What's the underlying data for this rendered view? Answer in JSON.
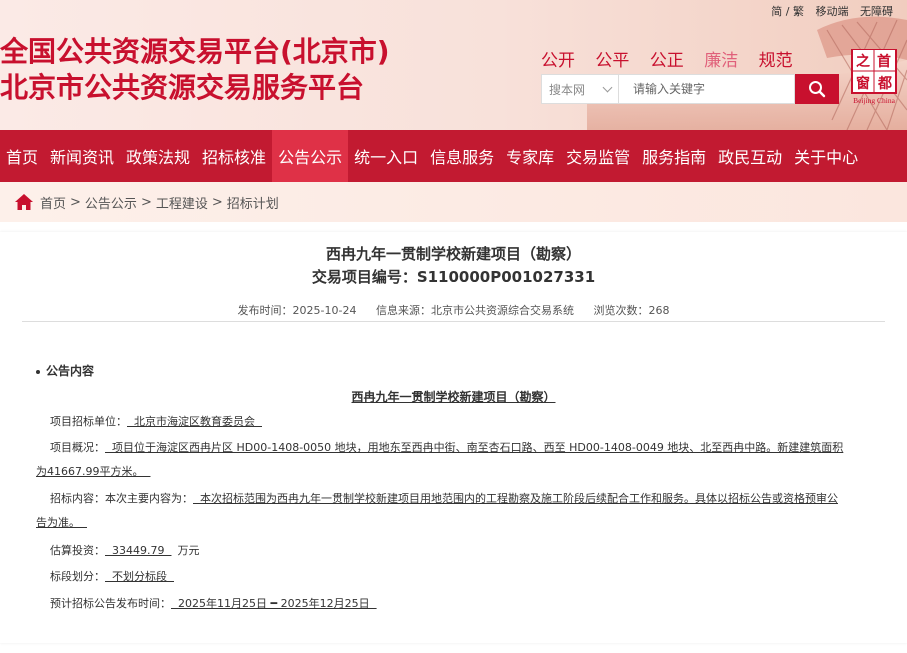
{
  "header": {
    "util_links": [
      "简 / 繁",
      "移动端",
      "无障碍"
    ],
    "title_line1": "全国公共资源交易平台(北京市)",
    "title_line2": "北京市公共资源交易服务平台",
    "slogans": [
      "公开",
      "公平",
      "公正",
      "廉洁",
      "规范"
    ],
    "search_scope": "搜本网",
    "search_placeholder": "请输入关键字",
    "logo_text": "Beijing China",
    "logo_chars": [
      "首",
      "都",
      "之",
      "窗"
    ]
  },
  "nav": {
    "items": [
      "首页",
      "新闻资讯",
      "政策法规",
      "招标核准",
      "公告公示",
      "统一入口",
      "信息服务",
      "专家库",
      "交易监管",
      "服务指南",
      "政民互动",
      "关于中心"
    ],
    "active_index": 4
  },
  "breadcrumb": {
    "items": [
      "首页",
      "公告公示",
      "工程建设",
      "招标计划"
    ],
    "separators": [
      ">",
      ">",
      ">"
    ]
  },
  "article": {
    "title": "西冉九年一贯制学校新建项目（勘察）",
    "code_line": "交易项目编号：S110000P001027331",
    "publish_time": "发布时间：2025-10-24",
    "source": "信息来源：北京市公共资源综合交易系统",
    "views": "浏览次数：268"
  },
  "content": {
    "section_title": "公告内容",
    "center_title": "西冉九年一贯制学校新建项目（勘察）",
    "unit_label": "项目招标单位：",
    "unit_value": "  北京市海淀区教育委员会  ",
    "overview_label": "项目概况：",
    "overview_line1": "  项目位于海淀区西冉片区 HD00-1408-0050 地块，用地东至西冉中街、南至杏石口路、西至 HD00-1408-0049 地块、北至西冉中路。新建建筑面积",
    "overview_line2": "为41667.99平方米。  ",
    "scope_label": "招标内容：本次主要内容为：",
    "scope_line1": "  本次招标范围为西冉九年一贯制学校新建项目用地范围内的工程勘察及施工阶段后续配合工作和服务。具体以招标公告或资格预审公",
    "scope_line2": "告为准。  ",
    "invest_label": "估算投资：",
    "invest_value": "  33449.79  ",
    "invest_unit": "万元",
    "section_label": "标段划分：",
    "section_value": "  不划分标段  ",
    "plan_label": "预计招标公告发布时间：",
    "plan_value": "  2025年11月25日 ━ 2025年12月25日  "
  },
  "colors": {
    "brand_red": "#c8102e",
    "nav_red": "#c21a31",
    "nav_active": "#df3147"
  }
}
